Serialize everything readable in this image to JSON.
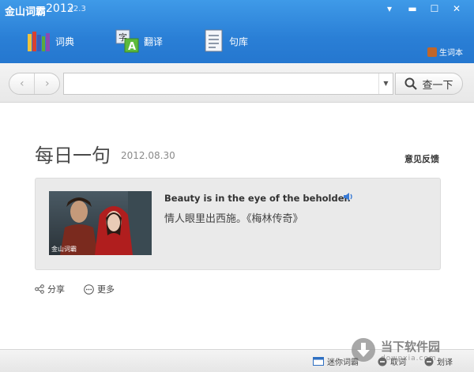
{
  "app": {
    "logo_text": "金山词霸",
    "year": "2012",
    "version": "v2.3"
  },
  "window_controls": {
    "menu": "▾",
    "minimize": "▬",
    "maximize": "☐",
    "close": "✕"
  },
  "tabs": [
    {
      "label": "词典",
      "icon": "books-icon"
    },
    {
      "label": "翻译",
      "icon": "translate-icon"
    },
    {
      "label": "句库",
      "icon": "document-icon"
    }
  ],
  "wordbook": {
    "label": "生词本",
    "icon": "wordbook-icon"
  },
  "search": {
    "back": "‹",
    "forward": "›",
    "value": "",
    "placeholder": "",
    "dropdown": "▼",
    "button_label": "查一下"
  },
  "daily": {
    "title": "每日一句",
    "date": "2012.08.30",
    "feedback": "意见反馈",
    "image_caption": "金山词霸",
    "quote_en": "Beauty is in the eye of the beholder.",
    "quote_cn": "情人眼里出西施。《梅林传奇》"
  },
  "actions": {
    "share": "分享",
    "more": "更多"
  },
  "statusbar": {
    "mini": "迷你词霸",
    "take": "取词",
    "translate": "划译"
  },
  "watermark": {
    "main": "当下软件园",
    "sub": "downxia.com"
  },
  "colors": {
    "header": "#2a7fd6",
    "accent": "#3f9ae8",
    "card": "#eaeaea"
  }
}
